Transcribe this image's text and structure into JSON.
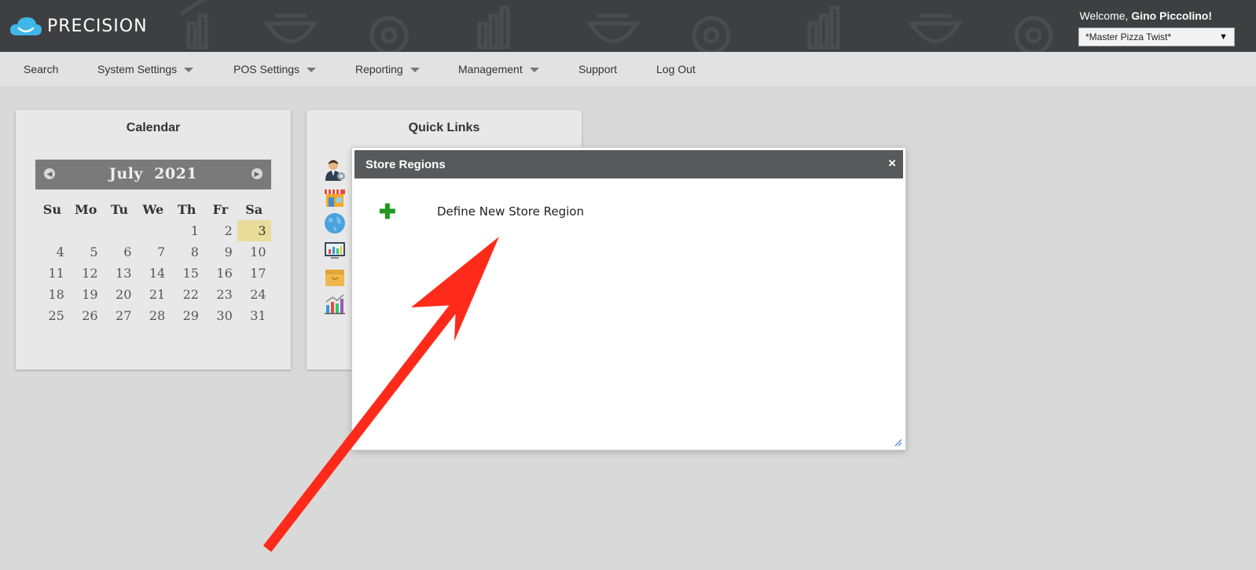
{
  "header": {
    "brand": "PRECISION",
    "welcome_prefix": "Welcome, ",
    "user_name": "Gino Piccolino!",
    "store_selected": "*Master Pizza Twist*"
  },
  "nav": {
    "items": [
      {
        "label": "Search"
      },
      {
        "label": "System Settings"
      },
      {
        "label": "POS Settings"
      },
      {
        "label": "Reporting"
      },
      {
        "label": "Management"
      },
      {
        "label": "Support"
      },
      {
        "label": "Log Out"
      }
    ]
  },
  "calendar": {
    "title": "Calendar",
    "month": "July",
    "year": "2021",
    "days_of_week": [
      "Su",
      "Mo",
      "Tu",
      "We",
      "Th",
      "Fr",
      "Sa"
    ],
    "weeks": [
      [
        "",
        "",
        "",
        "",
        "1",
        "2",
        "3"
      ],
      [
        "4",
        "5",
        "6",
        "7",
        "8",
        "9",
        "10"
      ],
      [
        "11",
        "12",
        "13",
        "14",
        "15",
        "16",
        "17"
      ],
      [
        "18",
        "19",
        "20",
        "21",
        "22",
        "23",
        "24"
      ],
      [
        "25",
        "26",
        "27",
        "28",
        "29",
        "30",
        "31"
      ]
    ],
    "today": "3"
  },
  "quick_links": {
    "title": "Quick Links",
    "icons": [
      "user-gear-icon",
      "storefront-icon",
      "globe-icon",
      "monitor-chart-icon",
      "box-icon",
      "bar-chart-icon"
    ]
  },
  "dialog": {
    "title": "Store Regions",
    "close_symbol": "×",
    "add_symbol": "✚",
    "action_label": "Define New Store Region"
  },
  "colors": {
    "header_bg": "#3d3f41",
    "nav_bg": "#e2e2e2",
    "dialog_bar": "#58595b",
    "today_highlight": "#e8dc9a",
    "add_green": "#1e9a1e",
    "annotation_arrow": "#ff2a1a"
  }
}
